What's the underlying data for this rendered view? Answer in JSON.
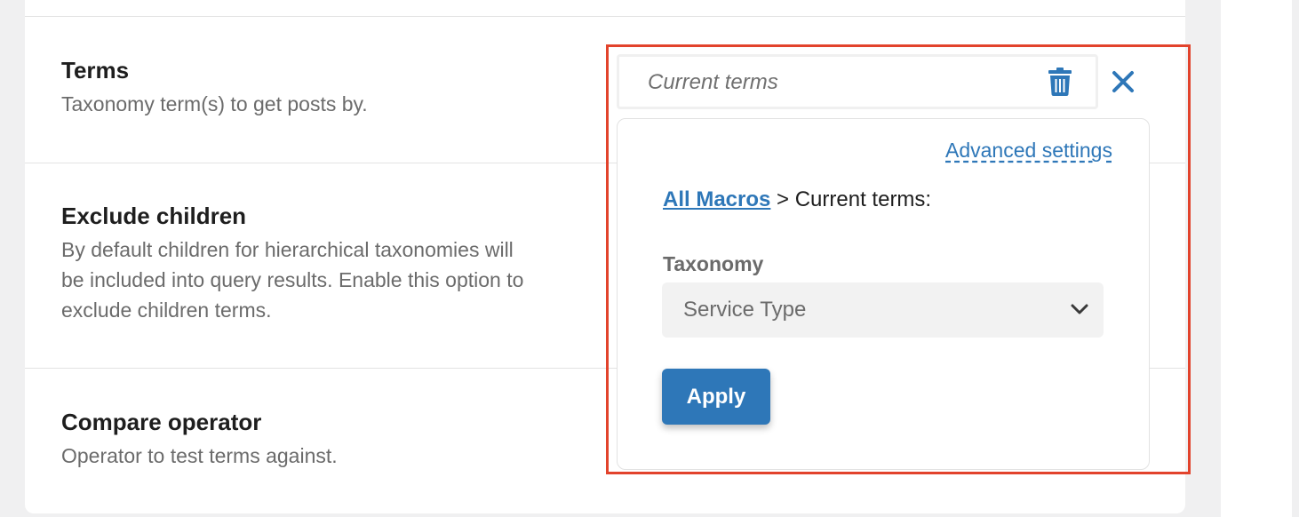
{
  "settings": {
    "rows": [
      {
        "title": "Terms",
        "description": [
          "Taxonomy term(s) to get posts by."
        ]
      },
      {
        "title": "Exclude children",
        "description": [
          "By default children for hierarchical taxonomies will",
          "be included into query results. Enable this option to",
          "exclude children terms."
        ]
      },
      {
        "title": "Compare operator",
        "description": [
          "Operator to test terms against."
        ]
      }
    ]
  },
  "terms_field": {
    "value": "Current terms",
    "delete_icon": "trash-icon",
    "close_icon": "close-x-icon"
  },
  "macro_popover": {
    "advanced_link": "Advanced settings",
    "breadcrumb_link": "All Macros",
    "breadcrumb_rest": " > Current terms:",
    "taxonomy_label": "Taxonomy",
    "taxonomy_selected": "Service Type",
    "apply_label": "Apply"
  },
  "colors": {
    "accent": "#2e77b8",
    "highlight_border": "#e2432c",
    "heading": "#1e1e1e",
    "muted": "#6b6b6b"
  }
}
